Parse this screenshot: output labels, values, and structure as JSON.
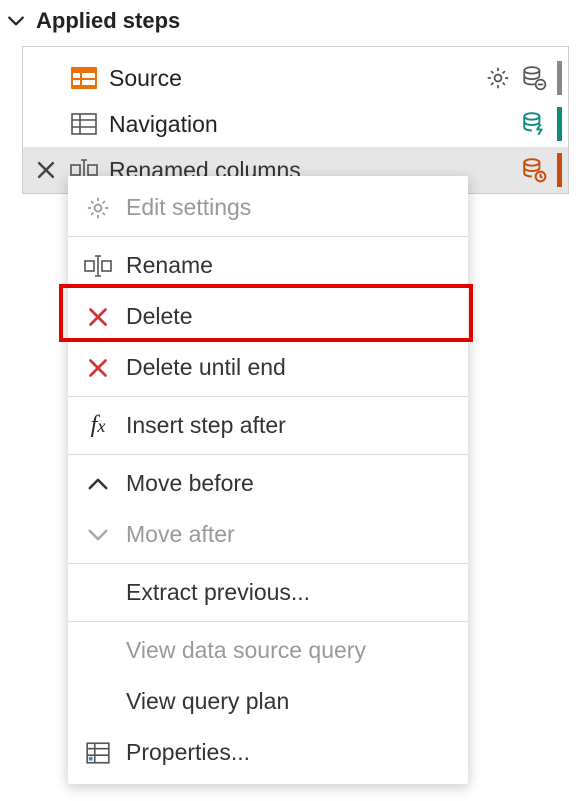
{
  "header": {
    "title": "Applied steps"
  },
  "steps": [
    {
      "label": "Source"
    },
    {
      "label": "Navigation"
    },
    {
      "label": "Renamed columns"
    }
  ],
  "contextMenu": {
    "edit_settings": "Edit settings",
    "rename": "Rename",
    "delete": "Delete",
    "delete_until_end": "Delete until end",
    "insert_step_after": "Insert step after",
    "move_before": "Move before",
    "move_after": "Move after",
    "extract_previous": "Extract previous...",
    "view_data_source_query": "View data source query",
    "view_query_plan": "View query plan",
    "properties": "Properties..."
  },
  "colors": {
    "accent_orange": "#e8710a",
    "accent_teal": "#0f8a85",
    "danger_red": "#d13438",
    "highlight_red": "#e60000"
  }
}
